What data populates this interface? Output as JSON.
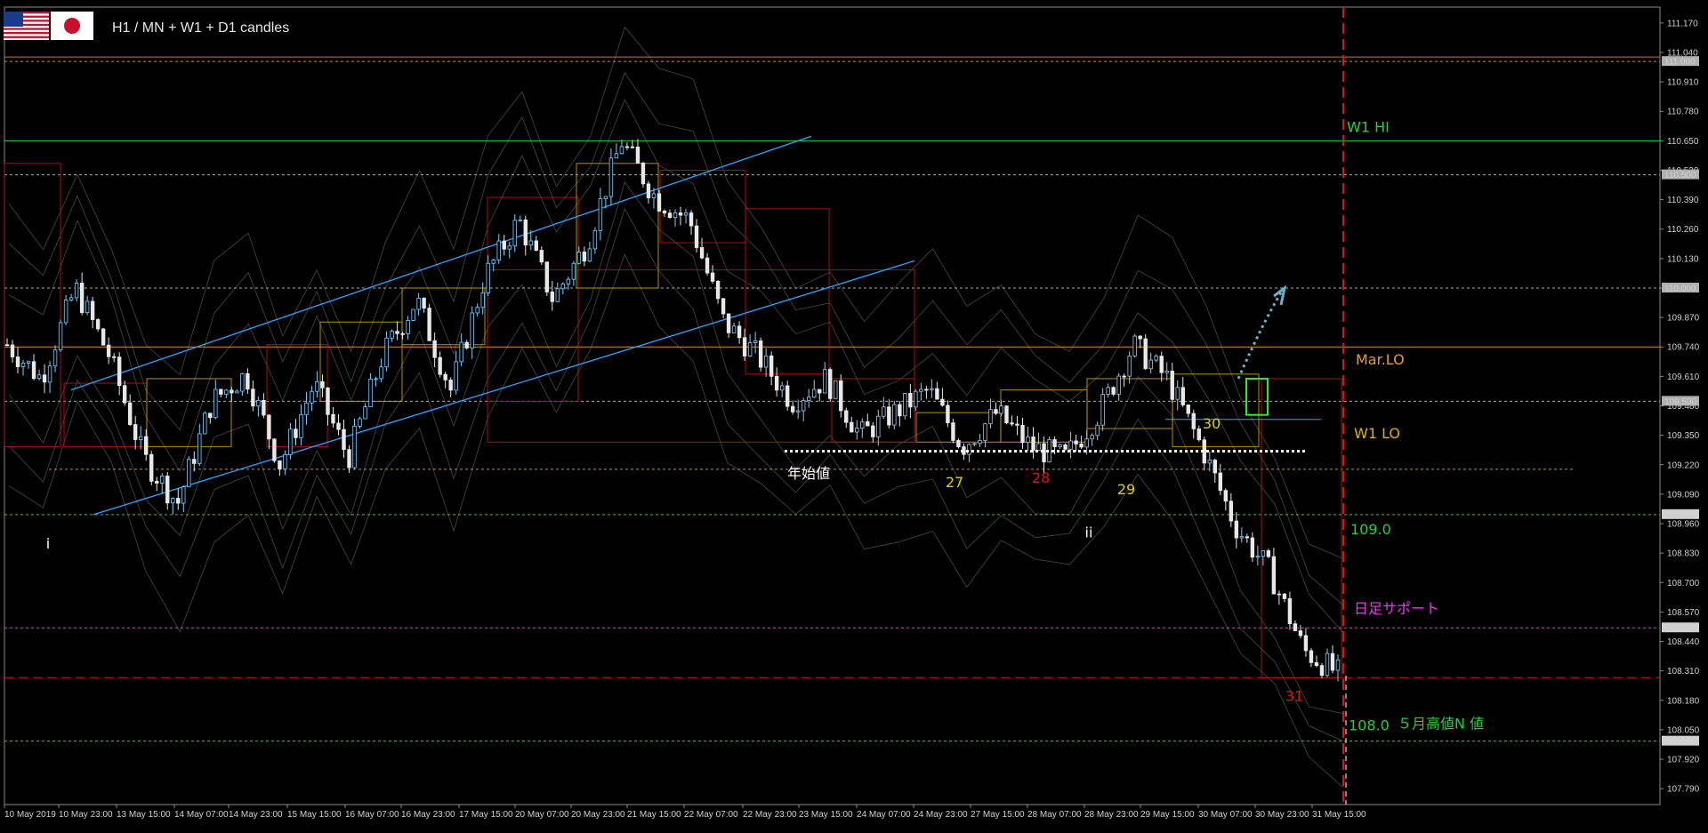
{
  "header": {
    "title": "H1 / MN + W1 + D1 candles",
    "flags": [
      "us-flag-icon",
      "japan-flag-icon"
    ]
  },
  "colors": {
    "background": "#000000",
    "bull": "#7fd0ff",
    "bear": "#e8e8e8",
    "green_line": "#2ecc40",
    "orange_line": "#e08a1e",
    "magenta_line": "#e83be8",
    "red_line": "#d01818",
    "channel": "#2aa7ff",
    "box_gold": "#c9a100",
    "box_red": "#c01010",
    "envelope": "#5a5a5a"
  },
  "chart_data": {
    "type": "candlestick",
    "title": "H1 / MN + W1 + D1 candles",
    "ylim": [
      107.72,
      111.24
    ],
    "y_ticks": [
      "111.170",
      "111.040",
      "110.910",
      "110.780",
      "110.650",
      "110.520",
      "110.390",
      "110.260",
      "110.130",
      "110.000",
      "109.870",
      "109.740",
      "109.610",
      "109.480",
      "109.350",
      "109.220",
      "109.090",
      "108.960",
      "108.830",
      "108.700",
      "108.570",
      "108.440",
      "108.310",
      "108.180",
      "108.050",
      "107.920",
      "107.790"
    ],
    "highlighted_ticks": [
      {
        "label": "111.000",
        "value": 111.0,
        "bg": "#b0b0b0"
      },
      {
        "label": "110.500",
        "value": 110.5,
        "bg": "#b0b0b0"
      },
      {
        "label": "110.000",
        "value": 110.0,
        "bg": "#b0b0b0"
      },
      {
        "label": "109.500",
        "value": 109.5,
        "bg": "#b0b0b0"
      },
      {
        "label": "109.000",
        "value": 109.0,
        "bg": "#d0d0d0"
      },
      {
        "label": "108.500",
        "value": 108.5,
        "bg": "#d0d0d0"
      },
      {
        "label": "108.000",
        "value": 108.0,
        "bg": "#d0d0d0"
      }
    ],
    "x_ticks": [
      "10 May 2019",
      "10 May 23:00",
      "13 May 15:00",
      "14 May 07:00",
      "14 May 23:00",
      "15 May 15:00",
      "16 May 07:00",
      "16 May 23:00",
      "17 May 15:00",
      "20 May 07:00",
      "20 May 23:00",
      "21 May 15:00",
      "22 May 07:00",
      "22 May 23:00",
      "23 May 15:00",
      "24 May 07:00",
      "24 May 23:00",
      "27 May 15:00",
      "28 May 07:00",
      "28 May 23:00",
      "29 May 15:00",
      "30 May 07:00",
      "30 May 23:00",
      "31 May 15:00"
    ],
    "price_path": [
      109.75,
      109.6,
      110.0,
      109.7,
      109.25,
      109.05,
      109.5,
      109.62,
      109.22,
      109.58,
      109.25,
      109.7,
      109.95,
      109.55,
      110.05,
      110.3,
      109.95,
      110.2,
      110.65,
      110.4,
      110.3,
      109.85,
      109.7,
      109.5,
      109.6,
      109.35,
      109.45,
      109.55,
      109.3,
      109.45,
      109.3,
      109.25,
      109.45,
      109.75,
      109.6,
      109.3,
      108.95,
      108.75,
      108.4,
      108.3
    ],
    "horizontal_levels": [
      {
        "value": 110.65,
        "color": "#2ecc40",
        "style": "solid",
        "label": "W1 HI"
      },
      {
        "value": 111.0,
        "color": "#e08a1e",
        "style": "dotted",
        "label": ""
      },
      {
        "value": 111.02,
        "color": "#c07a20",
        "style": "solid",
        "label": ""
      },
      {
        "value": 110.5,
        "color": "#aaaaaa",
        "style": "dotted",
        "label": ""
      },
      {
        "value": 110.0,
        "color": "#aaaaaa",
        "style": "dotted",
        "label": ""
      },
      {
        "value": 109.74,
        "color": "#e08a1e",
        "style": "solid",
        "label": "Mar.LO"
      },
      {
        "value": 109.5,
        "color": "#aaaaaa",
        "style": "dotted",
        "label": ""
      },
      {
        "value": 109.2,
        "color": "#e08a1e",
        "style": "dotted",
        "label": ""
      },
      {
        "value": 109.0,
        "color": "#2ecc40",
        "style": "dotted",
        "label": "109.0"
      },
      {
        "value": 108.5,
        "color": "#e83be8",
        "style": "dotted",
        "label": "日足サポート"
      },
      {
        "value": 108.28,
        "color": "#d01818",
        "style": "dashed",
        "label": ""
      },
      {
        "value": 108.0,
        "color": "#2ecc40",
        "style": "dotted",
        "label": "108.0"
      }
    ],
    "annotations": [
      {
        "text": "W1 HI",
        "color": "#2ecc40"
      },
      {
        "text": "Mar.LO",
        "color": "#e0a030"
      },
      {
        "text": "W1 LO",
        "color": "#e0b000"
      },
      {
        "text": "109.0",
        "color": "#2ecc40"
      },
      {
        "text": "日足サポート",
        "color": "#e83be8"
      },
      {
        "text": "108.0",
        "color": "#2ecc40"
      },
      {
        "text": "５月高値N 値",
        "color": "#2ecc40"
      },
      {
        "text": "年始値",
        "color": "#ffffff"
      },
      {
        "text": "27",
        "color": "#e0d000"
      },
      {
        "text": "28",
        "color": "#d01818"
      },
      {
        "text": "29",
        "color": "#e0d000"
      },
      {
        "text": "30",
        "color": "#e0d000"
      },
      {
        "text": "31",
        "color": "#d01818"
      },
      {
        "text": "i",
        "color": "#ffffff"
      },
      {
        "text": "ii",
        "color": "#ffffff"
      }
    ]
  }
}
